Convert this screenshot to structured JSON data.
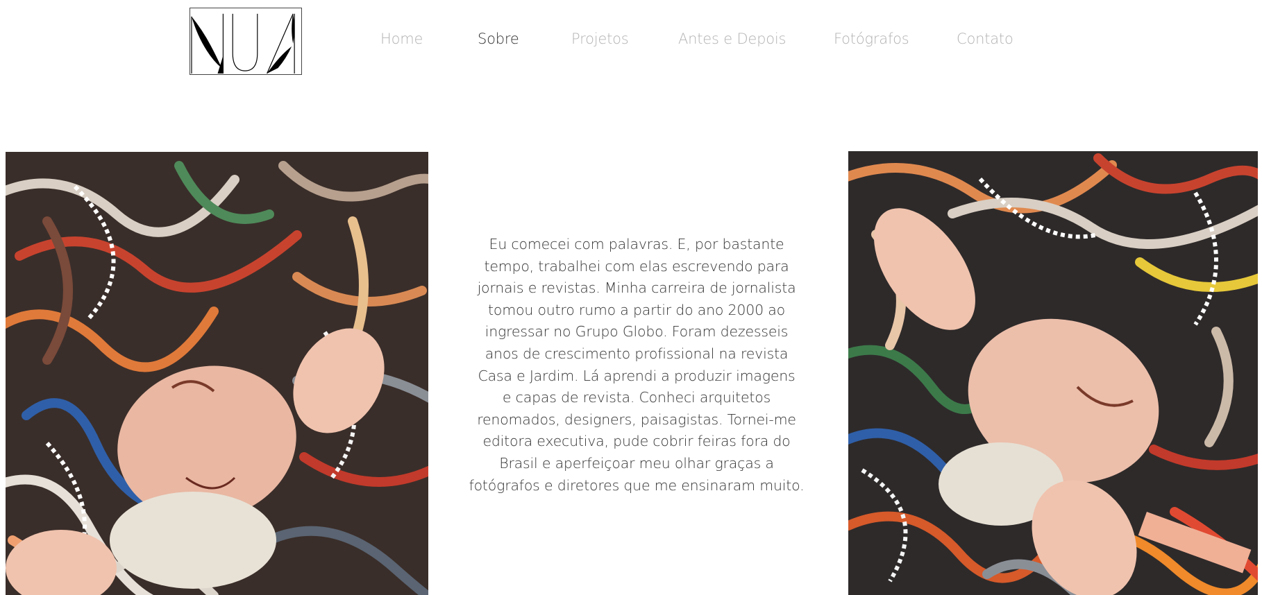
{
  "header": {
    "logo_text": "NUA",
    "nav": [
      {
        "label": "Home",
        "active": false
      },
      {
        "label": "Sobre",
        "active": true
      },
      {
        "label": "Projetos",
        "active": false
      },
      {
        "label": "Antes e Depois",
        "active": false
      },
      {
        "label": "Fotógrafos",
        "active": false
      },
      {
        "label": "Contato",
        "active": false
      }
    ]
  },
  "main": {
    "bio_lines": [
      "Eu comecei com palavras. E, por bastante",
      "tempo, trabalhei com elas escrevendo para",
      "jornais e revistas. Minha carreira de jornalista",
      "tomou outro rumo a partir do ano 2000 ao",
      "ingressar no Grupo Globo. Foram dezesseis",
      "anos de crescimento profissional na revista",
      "Casa e Jardim. Lá aprendi a produzir imagens",
      "e capas de revista. Conheci arquitetos",
      "renomados, designers, paisagistas. Tornei-me",
      "editora executiva, pude cobrir feiras fora do",
      "Brasil e aperfeiçoar meu olhar graças a",
      "fotógrafos e diretores que me ensinaram muito."
    ]
  },
  "colors": {
    "nav_inactive": "#b3b3b3",
    "nav_active": "#333333",
    "text": "#333333",
    "background": "#ffffff"
  }
}
